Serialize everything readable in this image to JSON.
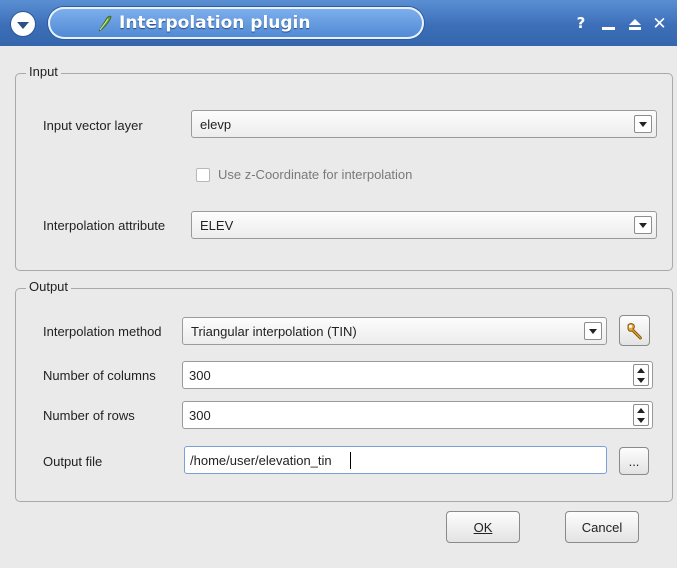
{
  "window": {
    "title": "Interpolation plugin",
    "help_glyph": "?",
    "close_glyph": "✕"
  },
  "input_group": {
    "title": "Input",
    "vector_layer_label": "Input vector layer",
    "vector_layer_value": "elevp",
    "use_z_label": "Use z-Coordinate for interpolation",
    "use_z_checked": false,
    "attribute_label": "Interpolation attribute",
    "attribute_value": "ELEV"
  },
  "output_group": {
    "title": "Output",
    "method_label": "Interpolation method",
    "method_value": "Triangular interpolation (TIN)",
    "columns_label": "Number of columns",
    "columns_value": "300",
    "rows_label": "Number of rows",
    "rows_value": "300",
    "output_file_label": "Output file",
    "output_file_value": "/home/user/elevation_tin",
    "browse_label": "..."
  },
  "buttons": {
    "ok_label": "OK",
    "cancel_label": "Cancel"
  },
  "colors": {
    "titlebar": "#3c6fb8",
    "accent": "#7aa0d6"
  },
  "icons": {
    "window_menu": "chevron-down-icon",
    "app": "quill-icon",
    "settings": "wrench-icon"
  }
}
